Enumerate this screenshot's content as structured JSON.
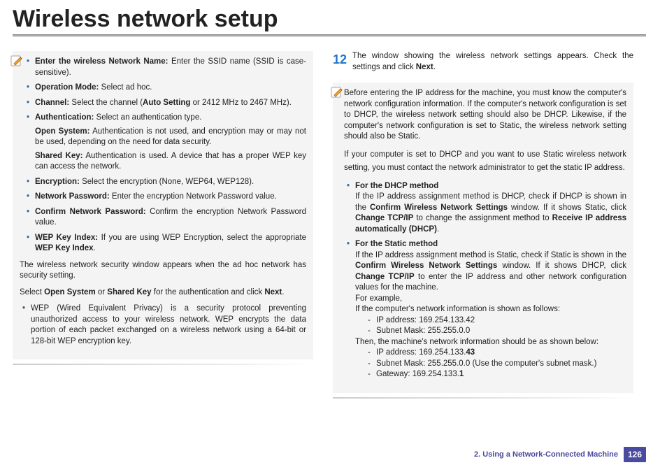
{
  "title": "Wireless network setup",
  "left": {
    "bullets": [
      {
        "label": "Enter the wireless Network Name:",
        "text": " Enter the SSID name (SSID is case-sensitive)."
      },
      {
        "label": "Operation Mode:",
        "text": " Select ad hoc."
      },
      {
        "label": "Channel:",
        "text": " Select the channel (",
        "boldTail": "Auto Setting",
        "after": " or 2412 MHz to 2467 MHz)."
      },
      {
        "label": "Authentication:",
        "text": " Select an authentication type.",
        "extras": [
          {
            "b": "Open System:",
            "t": " Authentication is not used, and encryption may or may not be used, depending on the need for data security."
          },
          {
            "b": "Shared Key:",
            "t": " Authentication is used. A device that has a proper WEP key can access the network."
          }
        ]
      },
      {
        "label": "Encryption:",
        "text": " Select the encryption (None, WEP64, WEP128)."
      },
      {
        "label": "Network Password:",
        "text": " Enter the encryption Network Password value."
      },
      {
        "label": "Confirm Network Password:",
        "text": " Confirm the encryption Network Password value."
      },
      {
        "label": "WEP Key Index:",
        "text": " If you are using WEP Encryption, select the appropriate ",
        "boldTail": "WEP Key Index",
        "after": "."
      }
    ],
    "para1": "The wireless network security window appears when the ad hoc network has security setting.",
    "para2_pre": "Select ",
    "para2_b1": "Open System",
    "para2_mid": " or ",
    "para2_b2": "Shared Key",
    "para2_post": " for the authentication and click ",
    "para2_b3": "Next",
    "wep_bullet": "WEP (Wired Equivalent Privacy) is a security protocol preventing unauthorized access to your wireless network. WEP encrypts the data portion of each packet exchanged on a wireless network using a 64-bit or 128-bit WEP encryption key."
  },
  "right": {
    "step_num": "12",
    "step_text_pre": "The window showing the wireless network settings appears. Check the settings and click ",
    "step_text_b": "Next",
    "note1": "Before entering the IP address for the machine, you must know the computer's network configuration information. If the computer's network configuration is set to DHCP, the wireless network setting should also be DHCP. Likewise, if the computer's network configuration is set to Static, the wireless network setting should also be Static.",
    "note2": "If your computer is set to DHCP and you want to use Static wireless network setting, you must contact the network administrator to get the static IP address.",
    "dhcp_title": "For the DHCP method",
    "dhcp_text_parts": {
      "a": "If the IP address assignment method is DHCP, check if DHCP is shown in the ",
      "b": "Confirm Wireless Network Settings",
      "c": " window. If it shows Static, click ",
      "d": "Change TCP/IP",
      "e": " to change the assignment method to ",
      "f": "Receive IP address automatically (DHCP)",
      "g": "."
    },
    "static_title": "For the Static method",
    "static_text_parts": {
      "a": "If the IP address assignment method is Static, check if Static is shown in the ",
      "b": "Confirm Wireless Network Settings",
      "c": " window. If it shows DHCP, click ",
      "d": "Change TCP/IP",
      "e": " to enter the IP address and other network configuration values for the machine."
    },
    "example_label": "For example,",
    "example_intro": "If the computer's network information is shown as follows:",
    "ex1": [
      "IP address: 169.254.133.42",
      "Subnet Mask: 255.255.0.0"
    ],
    "then": "Then, the machine's network information should be as shown below:",
    "ex2": [
      {
        "pre": "IP address: 169.254.133.",
        "b": "43"
      },
      {
        "pre": "Subnet Mask: 255.255.0.0 (Use the computer's subnet mask.)",
        "b": ""
      },
      {
        "pre": "Gateway: 169.254.133.",
        "b": "1"
      }
    ]
  },
  "footer": {
    "chapter": "2.  Using a Network-Connected Machine",
    "page": "126"
  }
}
